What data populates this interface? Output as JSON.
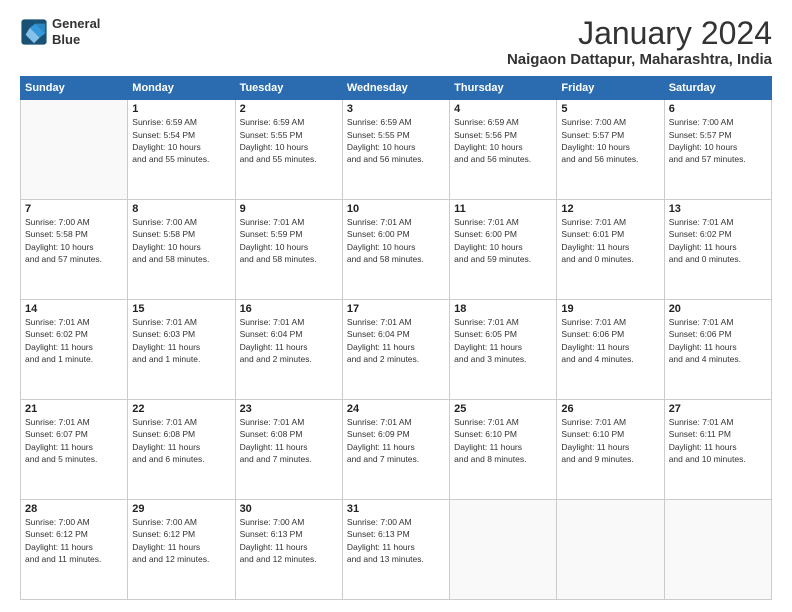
{
  "header": {
    "logo_line1": "General",
    "logo_line2": "Blue",
    "title": "January 2024",
    "subtitle": "Naigaon Dattapur, Maharashtra, India"
  },
  "weekdays": [
    "Sunday",
    "Monday",
    "Tuesday",
    "Wednesday",
    "Thursday",
    "Friday",
    "Saturday"
  ],
  "weeks": [
    [
      {
        "day": "",
        "sunrise": "",
        "sunset": "",
        "daylight": ""
      },
      {
        "day": "1",
        "sunrise": "Sunrise: 6:59 AM",
        "sunset": "Sunset: 5:54 PM",
        "daylight": "Daylight: 10 hours and 55 minutes."
      },
      {
        "day": "2",
        "sunrise": "Sunrise: 6:59 AM",
        "sunset": "Sunset: 5:55 PM",
        "daylight": "Daylight: 10 hours and 55 minutes."
      },
      {
        "day": "3",
        "sunrise": "Sunrise: 6:59 AM",
        "sunset": "Sunset: 5:55 PM",
        "daylight": "Daylight: 10 hours and 56 minutes."
      },
      {
        "day": "4",
        "sunrise": "Sunrise: 6:59 AM",
        "sunset": "Sunset: 5:56 PM",
        "daylight": "Daylight: 10 hours and 56 minutes."
      },
      {
        "day": "5",
        "sunrise": "Sunrise: 7:00 AM",
        "sunset": "Sunset: 5:57 PM",
        "daylight": "Daylight: 10 hours and 56 minutes."
      },
      {
        "day": "6",
        "sunrise": "Sunrise: 7:00 AM",
        "sunset": "Sunset: 5:57 PM",
        "daylight": "Daylight: 10 hours and 57 minutes."
      }
    ],
    [
      {
        "day": "7",
        "sunrise": "Sunrise: 7:00 AM",
        "sunset": "Sunset: 5:58 PM",
        "daylight": "Daylight: 10 hours and 57 minutes."
      },
      {
        "day": "8",
        "sunrise": "Sunrise: 7:00 AM",
        "sunset": "Sunset: 5:58 PM",
        "daylight": "Daylight: 10 hours and 58 minutes."
      },
      {
        "day": "9",
        "sunrise": "Sunrise: 7:01 AM",
        "sunset": "Sunset: 5:59 PM",
        "daylight": "Daylight: 10 hours and 58 minutes."
      },
      {
        "day": "10",
        "sunrise": "Sunrise: 7:01 AM",
        "sunset": "Sunset: 6:00 PM",
        "daylight": "Daylight: 10 hours and 58 minutes."
      },
      {
        "day": "11",
        "sunrise": "Sunrise: 7:01 AM",
        "sunset": "Sunset: 6:00 PM",
        "daylight": "Daylight: 10 hours and 59 minutes."
      },
      {
        "day": "12",
        "sunrise": "Sunrise: 7:01 AM",
        "sunset": "Sunset: 6:01 PM",
        "daylight": "Daylight: 11 hours and 0 minutes."
      },
      {
        "day": "13",
        "sunrise": "Sunrise: 7:01 AM",
        "sunset": "Sunset: 6:02 PM",
        "daylight": "Daylight: 11 hours and 0 minutes."
      }
    ],
    [
      {
        "day": "14",
        "sunrise": "Sunrise: 7:01 AM",
        "sunset": "Sunset: 6:02 PM",
        "daylight": "Daylight: 11 hours and 1 minute."
      },
      {
        "day": "15",
        "sunrise": "Sunrise: 7:01 AM",
        "sunset": "Sunset: 6:03 PM",
        "daylight": "Daylight: 11 hours and 1 minute."
      },
      {
        "day": "16",
        "sunrise": "Sunrise: 7:01 AM",
        "sunset": "Sunset: 6:04 PM",
        "daylight": "Daylight: 11 hours and 2 minutes."
      },
      {
        "day": "17",
        "sunrise": "Sunrise: 7:01 AM",
        "sunset": "Sunset: 6:04 PM",
        "daylight": "Daylight: 11 hours and 2 minutes."
      },
      {
        "day": "18",
        "sunrise": "Sunrise: 7:01 AM",
        "sunset": "Sunset: 6:05 PM",
        "daylight": "Daylight: 11 hours and 3 minutes."
      },
      {
        "day": "19",
        "sunrise": "Sunrise: 7:01 AM",
        "sunset": "Sunset: 6:06 PM",
        "daylight": "Daylight: 11 hours and 4 minutes."
      },
      {
        "day": "20",
        "sunrise": "Sunrise: 7:01 AM",
        "sunset": "Sunset: 6:06 PM",
        "daylight": "Daylight: 11 hours and 4 minutes."
      }
    ],
    [
      {
        "day": "21",
        "sunrise": "Sunrise: 7:01 AM",
        "sunset": "Sunset: 6:07 PM",
        "daylight": "Daylight: 11 hours and 5 minutes."
      },
      {
        "day": "22",
        "sunrise": "Sunrise: 7:01 AM",
        "sunset": "Sunset: 6:08 PM",
        "daylight": "Daylight: 11 hours and 6 minutes."
      },
      {
        "day": "23",
        "sunrise": "Sunrise: 7:01 AM",
        "sunset": "Sunset: 6:08 PM",
        "daylight": "Daylight: 11 hours and 7 minutes."
      },
      {
        "day": "24",
        "sunrise": "Sunrise: 7:01 AM",
        "sunset": "Sunset: 6:09 PM",
        "daylight": "Daylight: 11 hours and 7 minutes."
      },
      {
        "day": "25",
        "sunrise": "Sunrise: 7:01 AM",
        "sunset": "Sunset: 6:10 PM",
        "daylight": "Daylight: 11 hours and 8 minutes."
      },
      {
        "day": "26",
        "sunrise": "Sunrise: 7:01 AM",
        "sunset": "Sunset: 6:10 PM",
        "daylight": "Daylight: 11 hours and 9 minutes."
      },
      {
        "day": "27",
        "sunrise": "Sunrise: 7:01 AM",
        "sunset": "Sunset: 6:11 PM",
        "daylight": "Daylight: 11 hours and 10 minutes."
      }
    ],
    [
      {
        "day": "28",
        "sunrise": "Sunrise: 7:00 AM",
        "sunset": "Sunset: 6:12 PM",
        "daylight": "Daylight: 11 hours and 11 minutes."
      },
      {
        "day": "29",
        "sunrise": "Sunrise: 7:00 AM",
        "sunset": "Sunset: 6:12 PM",
        "daylight": "Daylight: 11 hours and 12 minutes."
      },
      {
        "day": "30",
        "sunrise": "Sunrise: 7:00 AM",
        "sunset": "Sunset: 6:13 PM",
        "daylight": "Daylight: 11 hours and 12 minutes."
      },
      {
        "day": "31",
        "sunrise": "Sunrise: 7:00 AM",
        "sunset": "Sunset: 6:13 PM",
        "daylight": "Daylight: 11 hours and 13 minutes."
      },
      {
        "day": "",
        "sunrise": "",
        "sunset": "",
        "daylight": ""
      },
      {
        "day": "",
        "sunrise": "",
        "sunset": "",
        "daylight": ""
      },
      {
        "day": "",
        "sunrise": "",
        "sunset": "",
        "daylight": ""
      }
    ]
  ]
}
